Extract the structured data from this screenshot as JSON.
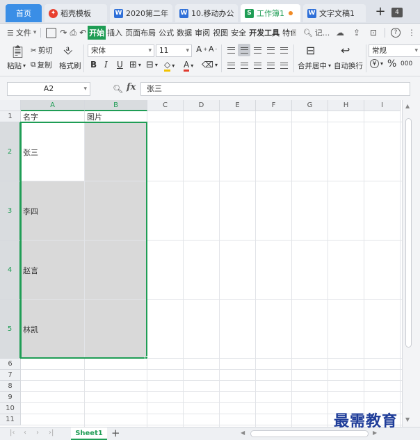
{
  "tabs": {
    "home": "首页",
    "items": [
      {
        "label": "稻壳模板",
        "icon": "docer-icon"
      },
      {
        "label": "2020第二年",
        "icon": "word-icon"
      },
      {
        "label": "10.移动办公",
        "icon": "word-icon"
      },
      {
        "label": "工作簿1",
        "icon": "sheet-icon",
        "active": true
      },
      {
        "label": "文字文稿1",
        "icon": "word-icon"
      }
    ],
    "count": "4"
  },
  "menu": {
    "file": "文件",
    "items": [
      "开始",
      "插入",
      "页面布局",
      "公式",
      "数据",
      "审阅",
      "视图",
      "安全",
      "开发工具",
      "特色"
    ],
    "active": "开始",
    "search": "记..."
  },
  "ribbon": {
    "paste": "粘贴",
    "cut": "剪切",
    "copy": "复制",
    "format_painter": "格式刷",
    "font": "宋体",
    "font_size": "11",
    "bold": "B",
    "italic": "I",
    "underline": "U",
    "font_color_sample": "A",
    "merge_center": "合并居中",
    "wrap_text": "自动换行",
    "number_format": "常规",
    "currency": "¥",
    "percent": "%",
    "comma": "000"
  },
  "formula_bar": {
    "name_box": "A2",
    "fx": "fx",
    "content": "张三"
  },
  "grid": {
    "columns": [
      "A",
      "B",
      "C",
      "D",
      "E",
      "F",
      "G",
      "H",
      "I"
    ],
    "rows": [
      "1",
      "2",
      "3",
      "4",
      "5",
      "6",
      "7",
      "8",
      "9",
      "10",
      "11"
    ],
    "cells": {
      "A1": "名字",
      "B1": "图片",
      "A2": "张三",
      "A3": "李四",
      "A4": "赵言",
      "A5": "林凯"
    },
    "selection_color": "#1f9d55"
  },
  "sheets": {
    "active": "Sheet1",
    "add": "+"
  },
  "watermark": "最需教育"
}
